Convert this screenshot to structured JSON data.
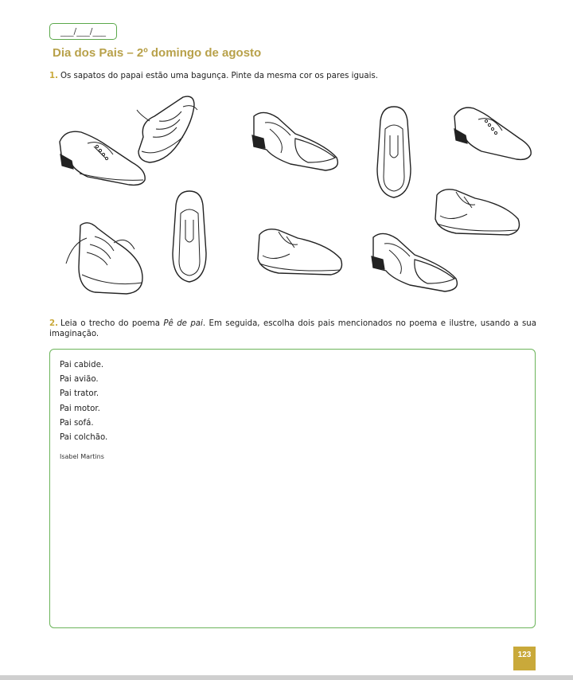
{
  "date_field": "___/___/___",
  "title": "Dia dos Pais – 2º domingo de agosto",
  "question1": {
    "number": "1.",
    "text": "Os sapatos do papai estão uma bagunça. Pinte da mesma cor os pares iguais."
  },
  "shoes": [
    {
      "icon": "lace-up-derby-shoe-icon"
    },
    {
      "icon": "sneaker-icon"
    },
    {
      "icon": "wingtip-oxford-shoe-icon"
    },
    {
      "icon": "slip-on-loafer-top-view-icon"
    },
    {
      "icon": "lace-up-derby-shoe-icon"
    },
    {
      "icon": "oxford-shoe-icon"
    },
    {
      "icon": "sneaker-icon"
    },
    {
      "icon": "slip-on-loafer-top-view-icon"
    },
    {
      "icon": "oxford-shoe-icon"
    },
    {
      "icon": "wingtip-oxford-shoe-icon"
    }
  ],
  "question2": {
    "number": "2.",
    "text_before": "Leia o trecho do poema ",
    "poem_title": "Pê de pai",
    "text_after": ". Em seguida, escolha dois pais mencionados no poema e ilustre, usando a sua imaginação."
  },
  "poem": {
    "lines": [
      "Pai cabide.",
      "Pai avião.",
      "Pai trator.",
      "Pai motor.",
      "Pai sofá.",
      "Pai colchão."
    ],
    "author": "Isabel Martins"
  },
  "page_number": "123",
  "colors": {
    "title": "#b8a14a",
    "accent": "#c9a93a",
    "border": "#6bb45a"
  }
}
